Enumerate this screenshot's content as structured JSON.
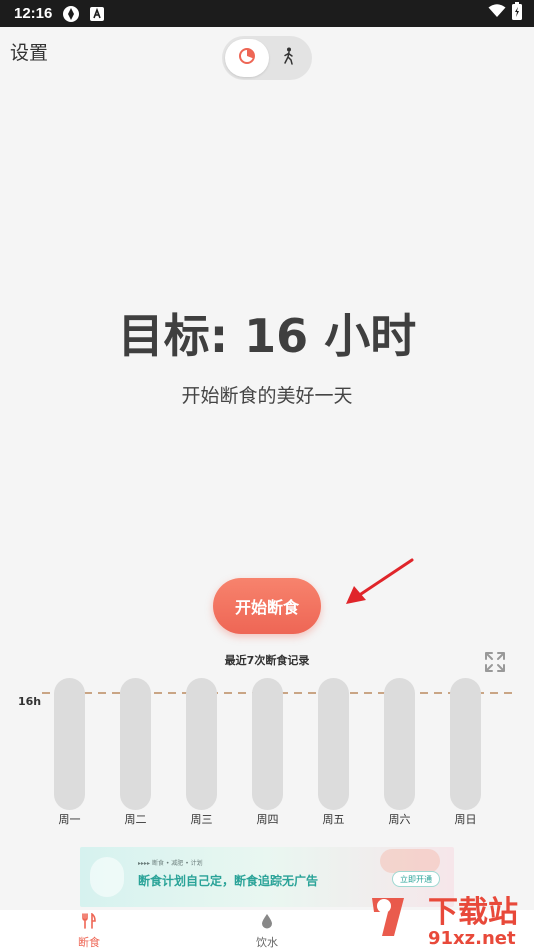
{
  "status_bar": {
    "time": "12:16"
  },
  "header": {
    "settings_label": "设置"
  },
  "goal": {
    "title": "目标: 16 小时",
    "subtitle": "开始断食的美好一天"
  },
  "start_button_label": "开始断食",
  "chart_data": {
    "type": "bar",
    "title": "最近7次断食记录",
    "categories": [
      "周一",
      "周二",
      "周三",
      "周四",
      "周五",
      "周六",
      "周日"
    ],
    "values": [
      0,
      0,
      0,
      0,
      0,
      0,
      0
    ],
    "target_line": {
      "label": "16h",
      "value": 16
    },
    "ylim": [
      0,
      20
    ],
    "track_color": "#dcdcdc",
    "target_line_color": "#c9a585"
  },
  "ad": {
    "top_text": "▸▸▸▸ 断食 • 减肥 • 计划",
    "main_text": "断食计划自己定，断食追踪无广告",
    "button_label": "立即开通"
  },
  "bottom_nav": {
    "items": [
      {
        "label": "断食",
        "icon": "fork-knife-icon",
        "active": true
      },
      {
        "label": "饮水",
        "icon": "water-drop-icon",
        "active": false
      }
    ]
  },
  "watermark": {
    "text": "下载站",
    "domain": "91xz.net"
  },
  "colors": {
    "accent": "#ee6655",
    "background": "#f5f5f5",
    "ad_teal": "#2aa398"
  }
}
